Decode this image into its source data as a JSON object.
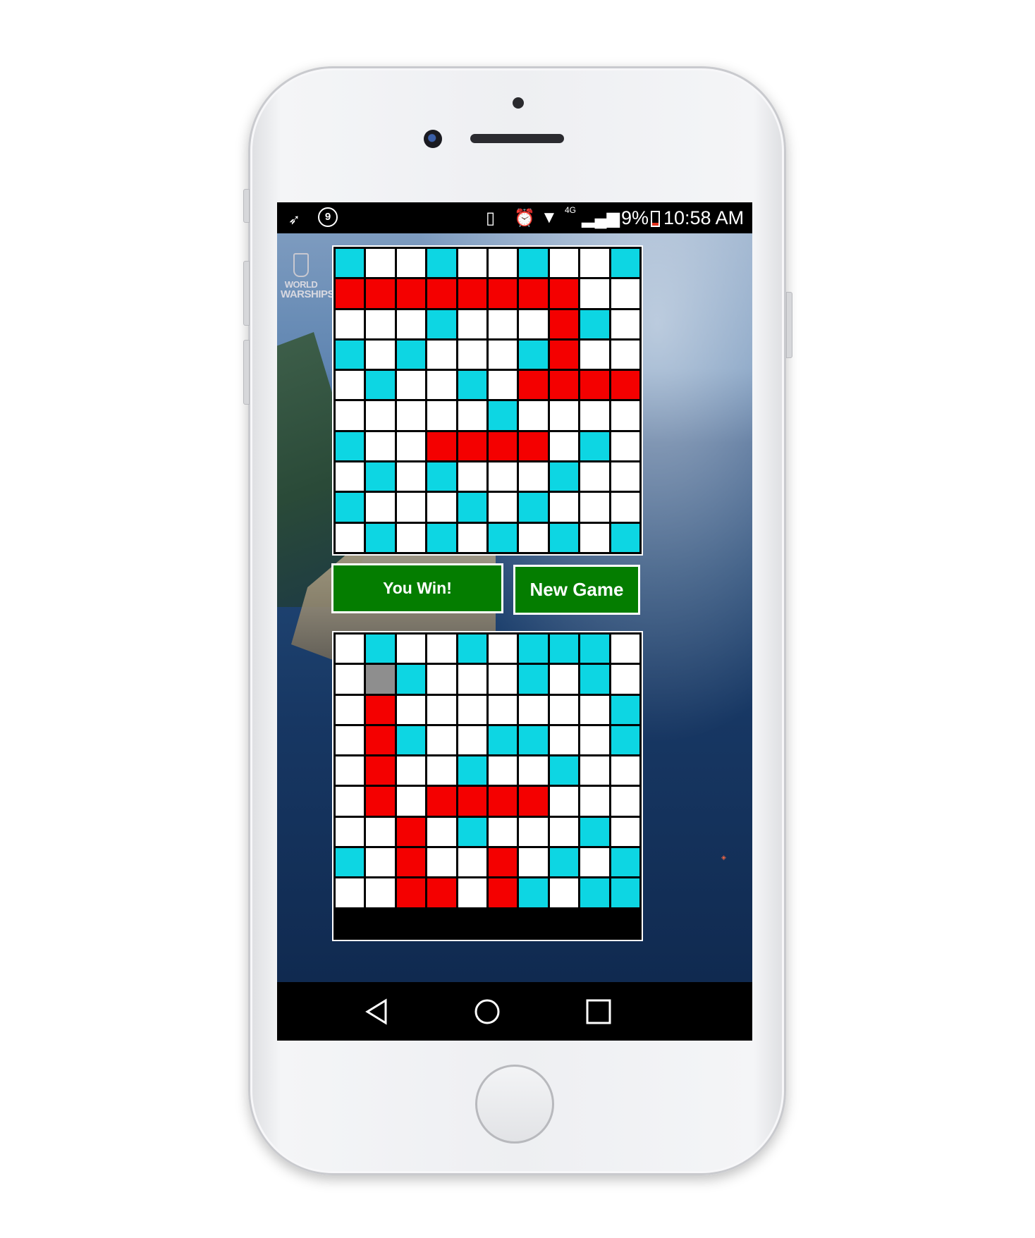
{
  "status_bar": {
    "notification_count": "9",
    "battery_percent": "9%",
    "time": "10:58 AM",
    "icons": [
      "leaf-icon",
      "notification-badge",
      "vibrate-icon",
      "alarm-icon",
      "wifi-icon",
      "lte-icon",
      "signal-icon",
      "battery-icon"
    ]
  },
  "game": {
    "logo_line1": "WORLD",
    "logo_line2": "WARSHIPS",
    "status_button_label": "You Win!",
    "new_game_label": "New Game",
    "cell_legend": {
      "W": "unknown",
      "M": "miss",
      "H": "hit",
      "S": "selected"
    },
    "colors": {
      "miss": "#0dd6e3",
      "hit": "#f40000",
      "button": "#047d00",
      "selected": "#8e8e8e"
    },
    "opponent_board": [
      "MWWMWWMWWM",
      "HHHHHHHHWW",
      "WWWMWWWHMW",
      "MWMWWWMHWW",
      "WMWWMWHHHH",
      "WWWWWMWWWW",
      "MWWHHHHWMW",
      "WMWMWWWMWW",
      "MWWWMWMWWW",
      "WMWMWMWMWM"
    ],
    "player_board": [
      "WMWWMWMMMW",
      "WSMWWWMWMW",
      "WHWWWWWWWM",
      "WHMWWMMWWM",
      "WHWWMWWMWW",
      "WHWHHHHWWW",
      "WWHWMWWWMW",
      "MWHWWHWMWM",
      "WWHHWHMWMM"
    ]
  },
  "nav_bar": {
    "buttons": [
      "back-icon",
      "home-icon",
      "recents-icon"
    ]
  }
}
